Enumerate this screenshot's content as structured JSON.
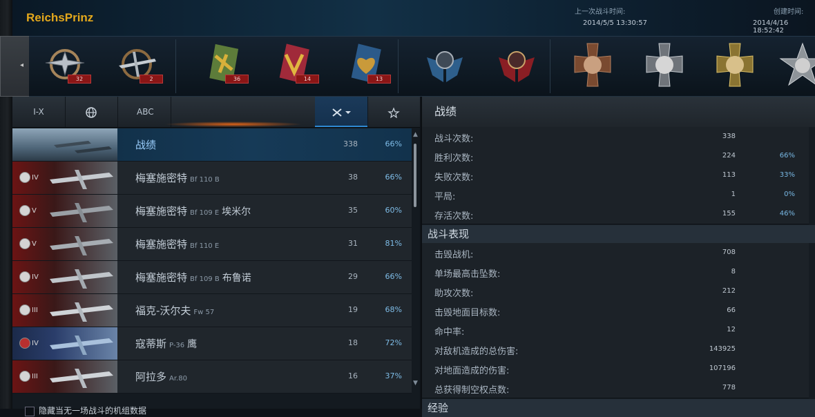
{
  "header": {
    "player_name": "ReichsPrinz",
    "last_battle_label": "上一次战斗时间:",
    "last_battle_value": "2014/5/5 13:30:57",
    "created_label": "创建时间:",
    "created_value": "2014/4/16 18:52:42"
  },
  "side_tab": {
    "arrow": "◂"
  },
  "medals": [
    {
      "icon": "wings-badge-icon",
      "count": "32"
    },
    {
      "icon": "propeller-plane-badge-icon",
      "count": "2"
    },
    {
      "icon": "plane-medal-green-icon",
      "count": "36"
    },
    {
      "icon": "v-medal-red-icon",
      "count": "14"
    },
    {
      "icon": "heart-medal-blue-icon",
      "count": "13"
    },
    {
      "icon": "blue-wings-emblem-icon",
      "count": ""
    },
    {
      "icon": "red-wings-emblem-icon",
      "count": ""
    },
    {
      "icon": "bronze-cross-portrait-icon",
      "count": ""
    },
    {
      "icon": "silver-cross-portrait-icon",
      "count": ""
    },
    {
      "icon": "gold-cross-portrait-icon",
      "count": ""
    },
    {
      "icon": "star-portrait-icon",
      "count": ""
    }
  ],
  "filters": {
    "tier_label": "I-X",
    "nation_icon": "globe-icon",
    "type_label": "ABC",
    "class_icon": "crossed-planes-icon",
    "rank_icon": "wings-star-icon"
  },
  "rows": [
    {
      "tier": "",
      "name": "战绩",
      "model": "",
      "nick": "",
      "battles": "338",
      "winrate": "66%"
    },
    {
      "tier": "IV",
      "name": "梅塞施密特",
      "model": "Bf 110 B",
      "nick": "",
      "battles": "38",
      "winrate": "66%"
    },
    {
      "tier": "V",
      "name": "梅塞施密特",
      "model": "Bf 109 E",
      "nick": "埃米尔",
      "battles": "35",
      "winrate": "60%"
    },
    {
      "tier": "V",
      "name": "梅塞施密特",
      "model": "Bf 110 E",
      "nick": "",
      "battles": "31",
      "winrate": "81%"
    },
    {
      "tier": "IV",
      "name": "梅塞施密特",
      "model": "Bf 109 B",
      "nick": "布鲁诺",
      "battles": "29",
      "winrate": "66%"
    },
    {
      "tier": "III",
      "name": "福克-沃尔夫",
      "model": "Fw 57",
      "nick": "",
      "battles": "19",
      "winrate": "68%"
    },
    {
      "tier": "IV",
      "name": "寇蒂斯",
      "model": "P-36",
      "nick": "鹰",
      "battles": "18",
      "winrate": "72%"
    },
    {
      "tier": "III",
      "name": "阿拉多",
      "model": "Ar.80",
      "nick": "",
      "battles": "16",
      "winrate": "37%"
    }
  ],
  "bottom_option": "隐藏当无一场战斗的机组数据",
  "right_panel": {
    "title": "战绩",
    "stats": [
      {
        "label": "战斗次数:",
        "value": "338",
        "pct": ""
      },
      {
        "label": "胜利次数:",
        "value": "224",
        "pct": "66%"
      },
      {
        "label": "失败次数:",
        "value": "113",
        "pct": "33%"
      },
      {
        "label": "平局:",
        "value": "1",
        "pct": "0%"
      },
      {
        "label": "存活次数:",
        "value": "155",
        "pct": "46%"
      }
    ],
    "section2_title": "战斗表现",
    "performance": [
      {
        "label": "击毁战机:",
        "value": "708"
      },
      {
        "label": "单场最高击坠数:",
        "value": "8"
      },
      {
        "label": "助攻次数:",
        "value": "212"
      },
      {
        "label": "击毁地面目标数:",
        "value": "66"
      },
      {
        "label": "命中率:",
        "value": "12"
      },
      {
        "label": "对敌机造成的总伤害:",
        "value": "143925"
      },
      {
        "label": "对地面造成的伤害:",
        "value": "107196"
      },
      {
        "label": "总获得制空权点数:",
        "value": "778"
      }
    ],
    "section3_title": "经验"
  },
  "colors": {
    "accent": "#2f8ad4",
    "gold": "#e4a81c",
    "badge_red": "#8b1616"
  }
}
